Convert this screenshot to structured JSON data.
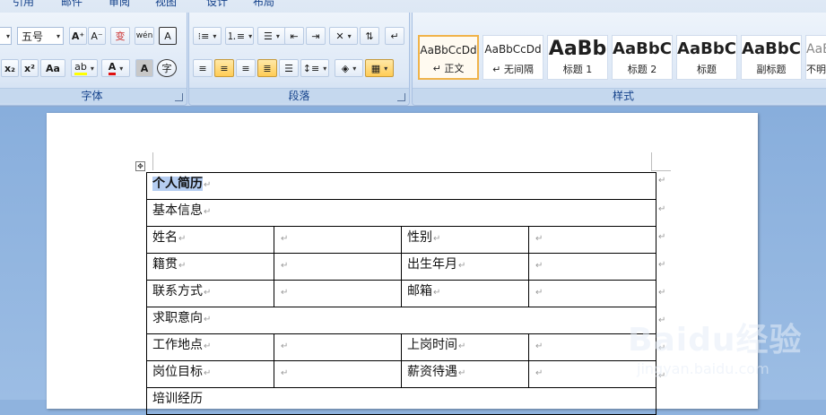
{
  "ribbon": {
    "tabs": [
      "引用",
      "邮件",
      "审阅",
      "视图",
      "设计",
      "布局"
    ],
    "font_group": {
      "label": "字体",
      "font_size": "五号",
      "buttons": {
        "grow": "A⁺",
        "shrink": "A⁻",
        "clear": "变",
        "phonetic": "wén",
        "border_char": "A",
        "subscript": "x₂",
        "superscript": "x²",
        "change_case": "Aa",
        "highlight": "ab",
        "font_color": "A",
        "char_shade": "A",
        "enclose": "字"
      }
    },
    "paragraph_group": {
      "label": "段落"
    },
    "styles_group": {
      "label": "样式",
      "styles": [
        {
          "sample": "AaBbCcDd",
          "name": "↵ 正文",
          "selected": true
        },
        {
          "sample": "AaBbCcDd",
          "name": "↵ 无间隔",
          "selected": false
        },
        {
          "sample": "AaBb",
          "name": "标题 1",
          "selected": false
        },
        {
          "sample": "AaBbC",
          "name": "标题 2",
          "selected": false
        },
        {
          "sample": "AaBbC",
          "name": "标题",
          "selected": false
        },
        {
          "sample": "AaBbC",
          "name": "副标题",
          "selected": false
        },
        {
          "sample": "AaBb",
          "name": "不明",
          "selected": false
        }
      ]
    },
    "colors": {
      "accent": "#c5d8ee",
      "selected_style_border": "#f0b34a",
      "font_color_bar": "#e01010",
      "highlight_bar": "#ffff00"
    }
  },
  "document": {
    "table": {
      "title": "个人简历",
      "sections": {
        "basic": "基本信息",
        "intent": "求职意向",
        "education": "培训经历"
      },
      "rows": {
        "r1": [
          "姓名",
          "",
          "性别",
          ""
        ],
        "r2": [
          "籍贯",
          "",
          "出生年月",
          ""
        ],
        "r3": [
          "联系方式",
          "",
          "邮箱",
          ""
        ],
        "r4": [
          "工作地点",
          "",
          "上岗时间",
          ""
        ],
        "r5": [
          "岗位目标",
          "",
          "薪资待遇",
          ""
        ]
      }
    },
    "paragraph_mark": "↵"
  },
  "watermark": {
    "brand": "Baidu经验",
    "url": "jingyan.baidu.com"
  }
}
